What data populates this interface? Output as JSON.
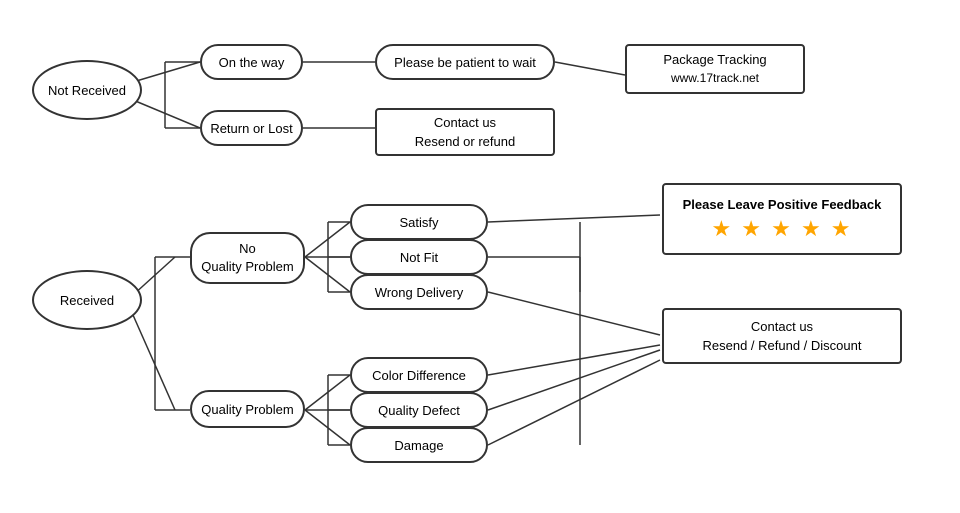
{
  "nodes": {
    "not_received": "Not\nReceived",
    "received": "Received",
    "on_the_way": "On the way",
    "return_or_lost": "Return or Lost",
    "patient": "Please be patient to wait",
    "contact_resend": "Contact us\nResend or refund",
    "package_tracking": "Package Tracking\nwww.17track.net",
    "no_quality_problem": "No\nQuality Problem",
    "quality_problem": "Quality Problem",
    "satisfy": "Satisfy",
    "not_fit": "Not Fit",
    "wrong_delivery": "Wrong Delivery",
    "color_difference": "Color Difference",
    "quality_defect": "Quality Defect",
    "damage": "Damage",
    "please_leave_feedback": "Please Leave Positive Feedback",
    "contact_resend2": "Contact us\nResend / Refund / Discount",
    "stars": "★ ★ ★ ★ ★"
  }
}
